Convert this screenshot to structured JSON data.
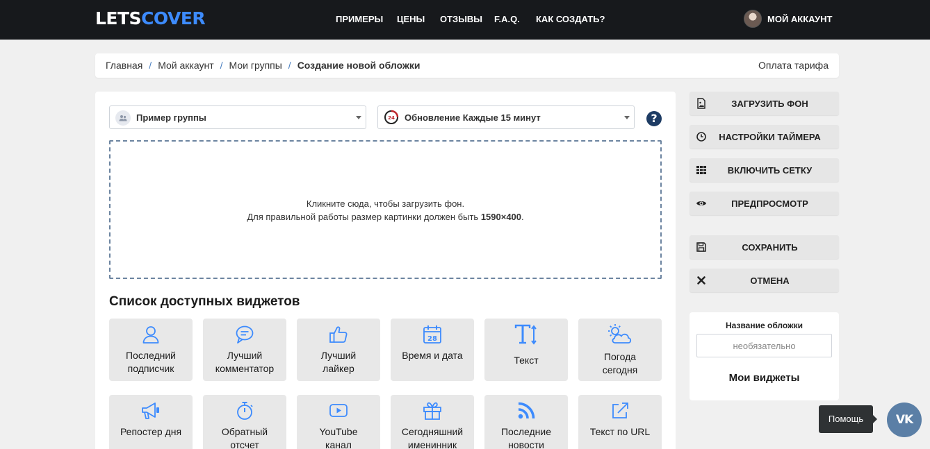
{
  "header": {
    "logo_part1": "LETS",
    "logo_part2": "COVER",
    "nav": [
      "ПРИМЕРЫ",
      "ЦЕНЫ",
      "ОТЗЫВЫ",
      "F.A.Q.",
      "КАК СОЗДАТЬ?"
    ],
    "account_label": "МОЙ АККАУНТ"
  },
  "breadcrumb": {
    "items": [
      "Главная",
      "Мой аккаунт",
      "Мои группы"
    ],
    "current": "Создание новой обложки",
    "separator": "/",
    "right_link": "Оплата тарифа"
  },
  "selectors": {
    "group": "Пример группы",
    "update": "Обновление Каждые 15 минут",
    "help": "?"
  },
  "dropzone": {
    "line1": "Кликните сюда, чтобы загрузить фон.",
    "line2_prefix": "Для правильной работы размер картинки должен быть ",
    "line2_size": "1590×400",
    "line2_suffix": "."
  },
  "widgets": {
    "title": "Список доступных виджетов",
    "items": [
      {
        "line1": "Последний",
        "line2": "подписчик",
        "icon": "user-icon"
      },
      {
        "line1": "Лучший",
        "line2": "комментатор",
        "icon": "comment-icon"
      },
      {
        "line1": "Лучший",
        "line2": "лайкер",
        "icon": "thumbs-up-icon"
      },
      {
        "line1": "Время и дата",
        "line2": "",
        "icon": "calendar-icon",
        "calendar_day": "28"
      },
      {
        "line1": "Текст",
        "line2": "",
        "icon": "text-icon"
      },
      {
        "line1": "Погода",
        "line2": "сегодня",
        "icon": "weather-icon"
      },
      {
        "line1": "Репостер дня",
        "line2": "",
        "icon": "megaphone-icon"
      },
      {
        "line1": "Обратный",
        "line2": "отсчет",
        "icon": "stopwatch-icon"
      },
      {
        "line1": "YouTube",
        "line2": "канал",
        "icon": "youtube-icon"
      },
      {
        "line1": "Сегодняшний",
        "line2": "именинник",
        "icon": "gift-icon"
      },
      {
        "line1": "Последние",
        "line2": "новости",
        "icon": "rss-icon"
      },
      {
        "line1": "Текст по URL",
        "line2": "",
        "icon": "external-link-icon"
      }
    ]
  },
  "sidebar": {
    "buttons": [
      {
        "label": "ЗАГРУЗИТЬ ФОН",
        "icon": "image-icon"
      },
      {
        "label": "НАСТРОЙКИ ТАЙМЕРА",
        "icon": "clock-icon"
      },
      {
        "label": "ВКЛЮЧИТЬ СЕТКУ",
        "icon": "grid-icon"
      },
      {
        "label": "ПРЕДПРОСМОТР",
        "icon": "eye-icon"
      },
      {
        "label": "СОХРАНИТЬ",
        "icon": "save-icon"
      },
      {
        "label": "ОТМЕНА",
        "icon": "close-icon"
      }
    ],
    "cover_name_label": "Название обложки",
    "cover_name_placeholder": "необязательно",
    "my_widgets": "Мои виджеты"
  },
  "help_widget": {
    "bubble": "Помощь",
    "vk": "VK"
  },
  "colors": {
    "header_bg": "#17191c",
    "logo_accent": "#3d8bfd",
    "icon_blue": "#3d8bfd",
    "help_bg": "#1e3c64",
    "vk_bg": "#5b7fa6"
  }
}
